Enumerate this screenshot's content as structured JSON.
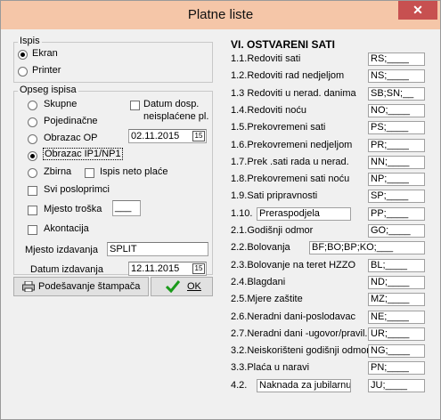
{
  "window": {
    "title": "Platne liste",
    "close_label": "✕"
  },
  "ispis": {
    "legend": "Ispis",
    "options": [
      "Ekran",
      "Printer"
    ],
    "selected": "Ekran"
  },
  "opseg": {
    "legend": "Opseg ispisa",
    "radios": [
      "Skupne",
      "Pojedinačne",
      "Obrazac OP",
      "Obrazac IP1/NP1",
      "Zbirna"
    ],
    "selected": "Obrazac IP1/NP1",
    "datum_dosp_label_1": "Datum dosp.",
    "datum_dosp_label_2": "neisplaćene pl.",
    "datum_dosp_value": "02.11.2015",
    "ispis_neto_label": "Ispis neto plaće",
    "svi_posloprimci_label": "Svi posloprimci",
    "mjesto_troska_label": "Mjesto troška",
    "mjesto_troska_value": "___",
    "akontacija_label": "Akontacija",
    "mjesto_izdavanja_label": "Mjesto izdavanja",
    "mjesto_izdavanja_value": "SPLIT",
    "datum_izdavanja_label": "Datum izdavanja",
    "datum_izdavanja_value": "12.11.2015",
    "cal_icon_text": "15"
  },
  "buttons": {
    "podesavanje_label": "Podešavanje štampača",
    "ok_label": "OK"
  },
  "section": {
    "header": "VI. OSTVARENI SATI",
    "rows": [
      {
        "label": "1.1.Redoviti sati",
        "code": "RS;____"
      },
      {
        "label": "1.2.Redoviti rad nedjeljom",
        "code": "NS;____"
      },
      {
        "label": "1.3 Redoviti u nerad. danima",
        "code": "SB;SN;__"
      },
      {
        "label": "1.4.Redoviti noću",
        "code": "NO;____"
      },
      {
        "label": "1.5.Prekovremeni  sati",
        "code": "PS;____"
      },
      {
        "label": "1.6.Prekovremeni nedjeljom",
        "code": "PR;____"
      },
      {
        "label": "1.7.Prek .sati rada u  nerad.",
        "code": "NN;____"
      },
      {
        "label": "1.8.Prekovremeni  sati noću",
        "code": "NP;____"
      },
      {
        "label": "1.9.Sati pripravnosti",
        "code": "SP;____"
      },
      {
        "label": "1.10.",
        "code": "PP;____",
        "extra": "Preraspodjela"
      },
      {
        "label": "2.1.Godišnji odmor",
        "code": "GO;____"
      },
      {
        "label": "2.2.Bolovanja",
        "code": "BF;BO;BP;KO;___"
      },
      {
        "label": "2.3.Bolovanje na teret HZZO",
        "code": "BL;____"
      },
      {
        "label": "2.4.Blagdani",
        "code": "ND;____"
      },
      {
        "label": "2.5.Mjere zaštite",
        "code": "MZ;____"
      },
      {
        "label": "2.6.Neradni dani-poslodavac",
        "code": "NE;____"
      },
      {
        "label": "2.7.Neradni dani -ugovor/pravil.",
        "code": "UR;____"
      },
      {
        "label": "3.2.Neiskorišteni godišnji odmor",
        "code": "NG;____"
      },
      {
        "label": "3.3.Plaća u naravi",
        "code": "PN;____"
      },
      {
        "label": "4.2.",
        "code": "JU;____",
        "extra": "Naknada za jubilarnu n"
      }
    ]
  }
}
